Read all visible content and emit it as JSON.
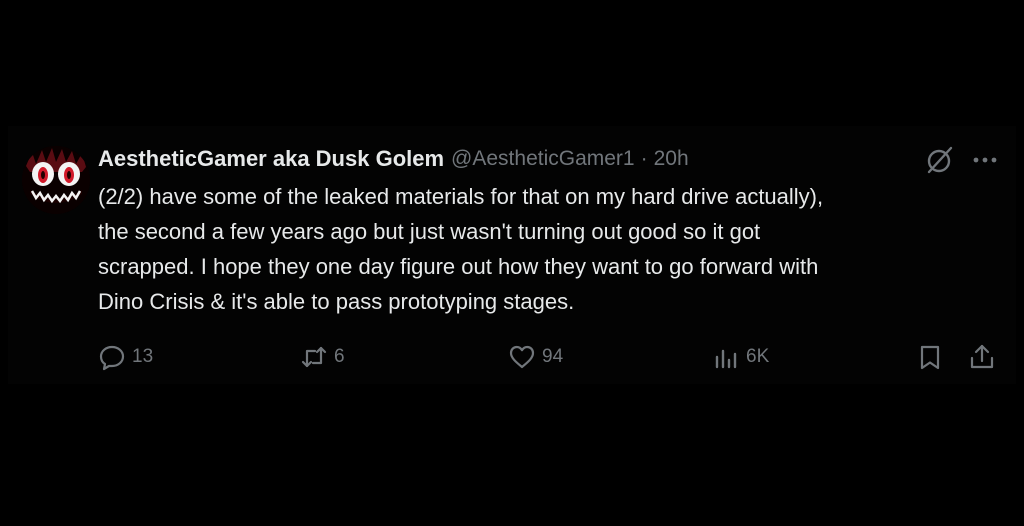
{
  "tweet": {
    "author": {
      "display_name": "AestheticGamer aka Dusk Golem",
      "handle": "@AestheticGamer1",
      "time": "20h"
    },
    "text_lines": [
      "(2/2) have some of the leaked materials for that on my hard drive actually),",
      "the second a few years ago but just wasn't turning out good so it got",
      "scrapped. I hope they one day figure out how they want to go forward with",
      "Dino Crisis & it's able to pass prototyping stages."
    ],
    "separator": "·",
    "actions": {
      "replies": {
        "icon": "reply-icon",
        "count": "13"
      },
      "reposts": {
        "icon": "repost-icon",
        "count": "6"
      },
      "likes": {
        "icon": "heart-icon",
        "count": "94"
      },
      "views": {
        "icon": "views-icon",
        "count": "6K"
      },
      "bookmark": {
        "icon": "bookmark-icon"
      },
      "share": {
        "icon": "share-icon"
      }
    },
    "header_icons": [
      "grok-icon",
      "more-icon"
    ]
  },
  "colors": {
    "background": "#000000",
    "primary_text": "#e7e9ea",
    "secondary_text": "#71767b",
    "avatar_accent": "#d11a2a"
  }
}
